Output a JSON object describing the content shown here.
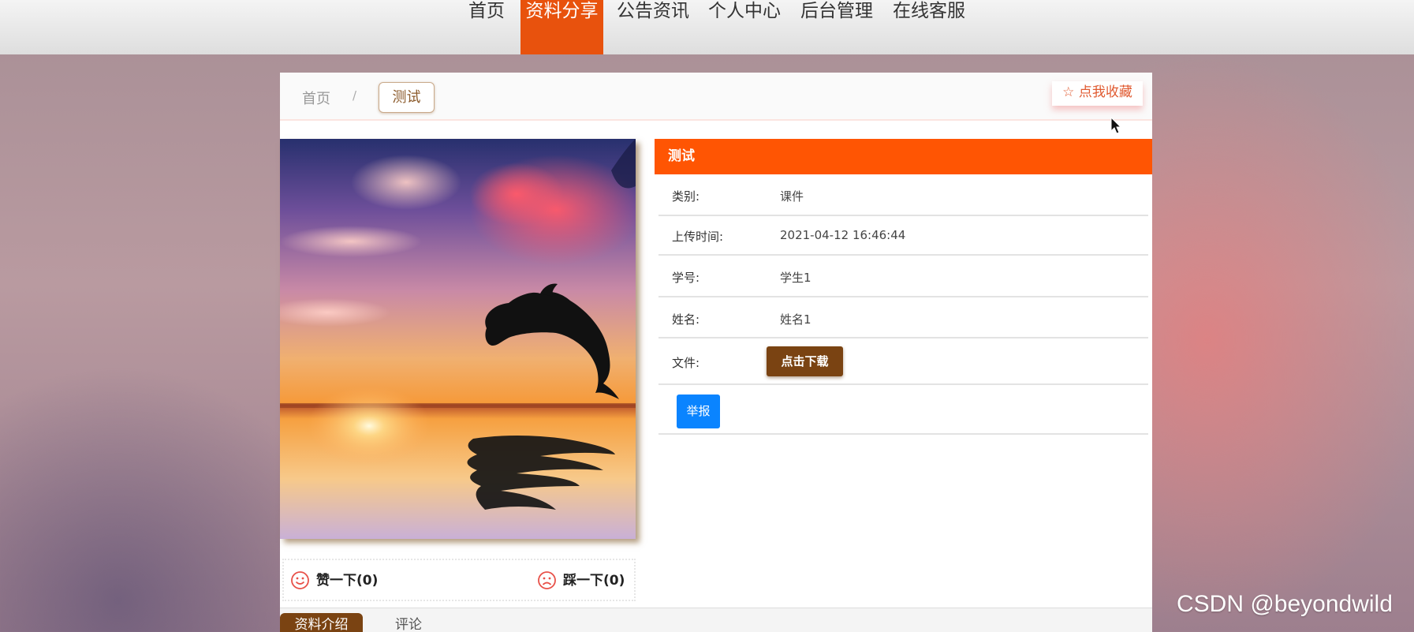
{
  "nav": {
    "items": [
      {
        "label": "首页"
      },
      {
        "label": "资料分享",
        "active": true
      },
      {
        "label": "公告资讯"
      },
      {
        "label": "个人中心"
      },
      {
        "label": "后台管理"
      },
      {
        "label": "在线客服"
      }
    ],
    "active_color": "#e8520d"
  },
  "breadcrumb": {
    "home": "首页",
    "separator": "/",
    "current": "测试"
  },
  "favorite": {
    "icon": "star-outline-icon",
    "label": "点我收藏"
  },
  "material": {
    "title": "测试",
    "title_bg": "#ff5503",
    "fields": [
      {
        "label": "类别:",
        "value": "课件"
      },
      {
        "label": "上传时间:",
        "value": "2021-04-12 16:46:44"
      },
      {
        "label": "学号:",
        "value": "学生1"
      },
      {
        "label": "姓名:",
        "value": "姓名1"
      }
    ],
    "file_label": "文件:",
    "download_label": "点击下载",
    "report_label": "举报"
  },
  "votes": {
    "like_label": "赞一下(0)",
    "like_icon": "smile-face-icon",
    "dislike_label": "踩一下(0)",
    "dislike_icon": "sad-face-icon"
  },
  "tabs": [
    {
      "label": "资料介绍",
      "active": true
    },
    {
      "label": "评论",
      "active": false
    }
  ],
  "watermark": "CSDN @beyondwild",
  "colors": {
    "brown": "#7a4312",
    "blue": "#0a84ff"
  }
}
